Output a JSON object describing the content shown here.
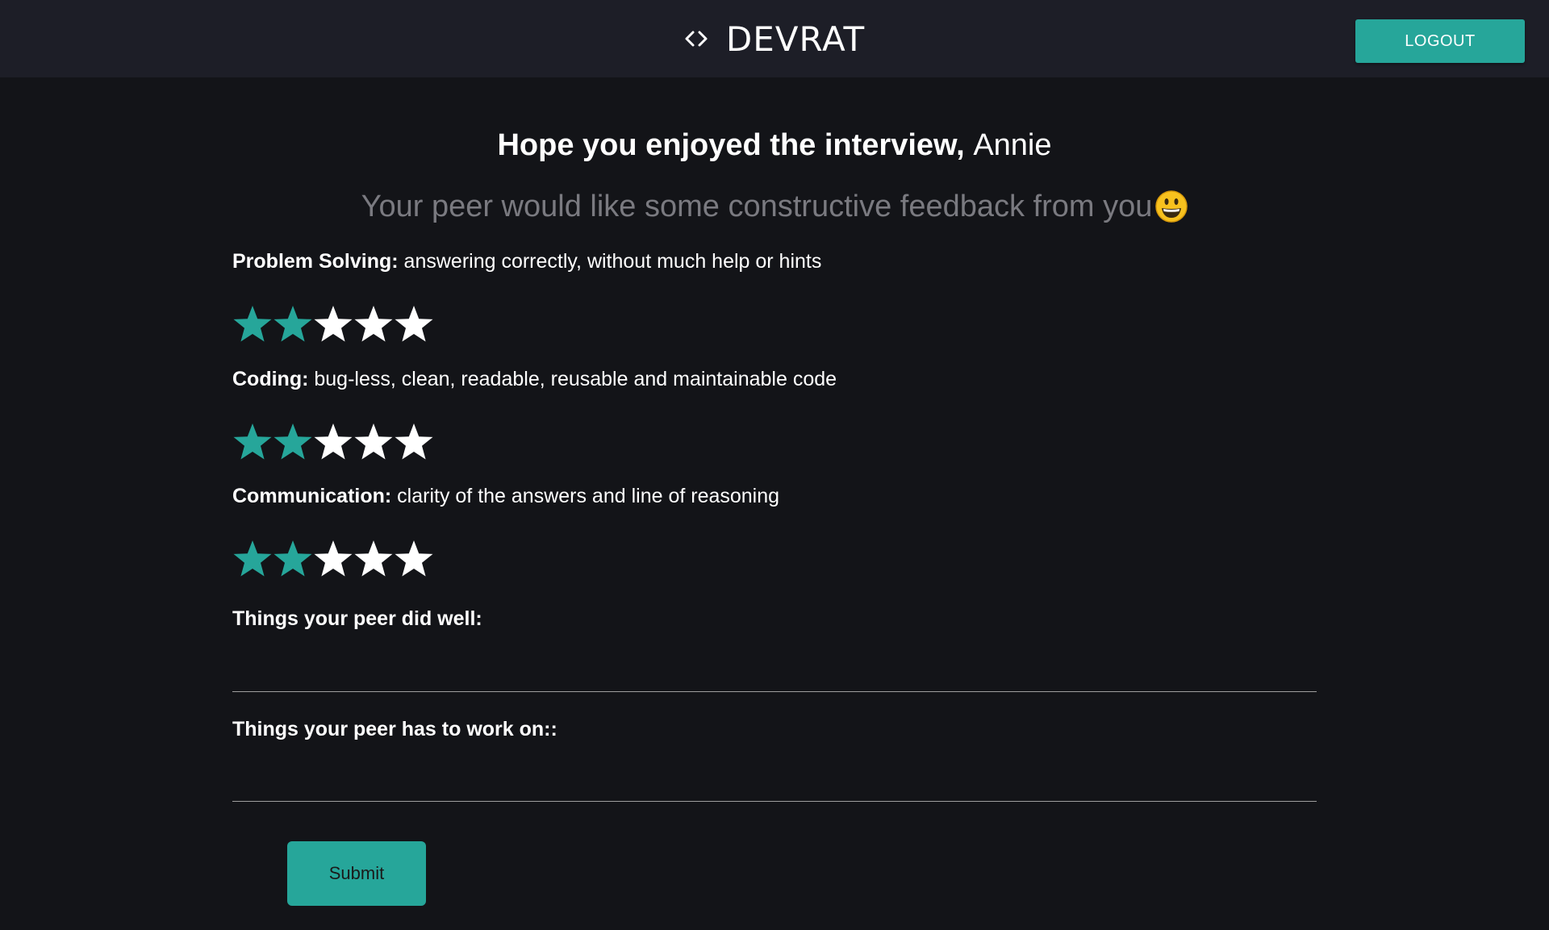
{
  "app": {
    "brand": "DEVRAT",
    "brand_icon": "code-brackets-icon",
    "logout_label": "LOGOUT",
    "accent_color": "#26a69a"
  },
  "page": {
    "heading_bold": "Hope you enjoyed the interview,",
    "heading_name": "Annie",
    "subheading": "Your peer would like some constructive feedback from you",
    "subheading_emoji": "grinning-face-icon"
  },
  "criteria": [
    {
      "title": "Problem Solving:",
      "description": "answering correctly, without much help or hints",
      "rating": 2,
      "max": 5
    },
    {
      "title": "Coding:",
      "description": "bug-less, clean, readable, reusable and maintainable code",
      "rating": 2,
      "max": 5
    },
    {
      "title": "Communication:",
      "description": "clarity of the answers and line of reasoning",
      "rating": 2,
      "max": 5
    }
  ],
  "fields": {
    "did_well_label": "Things your peer did well:",
    "did_well_value": "",
    "work_on_label": "Things your peer has to work on::",
    "work_on_value": ""
  },
  "submit_label": "Submit"
}
